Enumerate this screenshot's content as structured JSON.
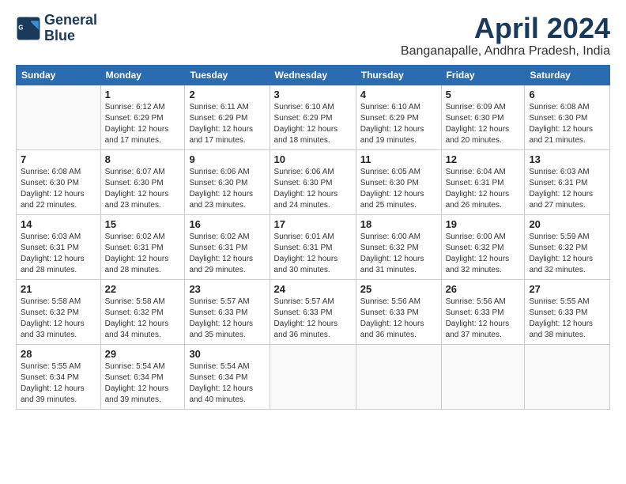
{
  "logo": {
    "line1": "General",
    "line2": "Blue"
  },
  "title": "April 2024",
  "subtitle": "Banganapalle, Andhra Pradesh, India",
  "days_of_week": [
    "Sunday",
    "Monday",
    "Tuesday",
    "Wednesday",
    "Thursday",
    "Friday",
    "Saturday"
  ],
  "weeks": [
    [
      {
        "day": "",
        "info": ""
      },
      {
        "day": "1",
        "info": "Sunrise: 6:12 AM\nSunset: 6:29 PM\nDaylight: 12 hours\nand 17 minutes."
      },
      {
        "day": "2",
        "info": "Sunrise: 6:11 AM\nSunset: 6:29 PM\nDaylight: 12 hours\nand 17 minutes."
      },
      {
        "day": "3",
        "info": "Sunrise: 6:10 AM\nSunset: 6:29 PM\nDaylight: 12 hours\nand 18 minutes."
      },
      {
        "day": "4",
        "info": "Sunrise: 6:10 AM\nSunset: 6:29 PM\nDaylight: 12 hours\nand 19 minutes."
      },
      {
        "day": "5",
        "info": "Sunrise: 6:09 AM\nSunset: 6:30 PM\nDaylight: 12 hours\nand 20 minutes."
      },
      {
        "day": "6",
        "info": "Sunrise: 6:08 AM\nSunset: 6:30 PM\nDaylight: 12 hours\nand 21 minutes."
      }
    ],
    [
      {
        "day": "7",
        "info": "Sunrise: 6:08 AM\nSunset: 6:30 PM\nDaylight: 12 hours\nand 22 minutes."
      },
      {
        "day": "8",
        "info": "Sunrise: 6:07 AM\nSunset: 6:30 PM\nDaylight: 12 hours\nand 23 minutes."
      },
      {
        "day": "9",
        "info": "Sunrise: 6:06 AM\nSunset: 6:30 PM\nDaylight: 12 hours\nand 23 minutes."
      },
      {
        "day": "10",
        "info": "Sunrise: 6:06 AM\nSunset: 6:30 PM\nDaylight: 12 hours\nand 24 minutes."
      },
      {
        "day": "11",
        "info": "Sunrise: 6:05 AM\nSunset: 6:30 PM\nDaylight: 12 hours\nand 25 minutes."
      },
      {
        "day": "12",
        "info": "Sunrise: 6:04 AM\nSunset: 6:31 PM\nDaylight: 12 hours\nand 26 minutes."
      },
      {
        "day": "13",
        "info": "Sunrise: 6:03 AM\nSunset: 6:31 PM\nDaylight: 12 hours\nand 27 minutes."
      }
    ],
    [
      {
        "day": "14",
        "info": "Sunrise: 6:03 AM\nSunset: 6:31 PM\nDaylight: 12 hours\nand 28 minutes."
      },
      {
        "day": "15",
        "info": "Sunrise: 6:02 AM\nSunset: 6:31 PM\nDaylight: 12 hours\nand 28 minutes."
      },
      {
        "day": "16",
        "info": "Sunrise: 6:02 AM\nSunset: 6:31 PM\nDaylight: 12 hours\nand 29 minutes."
      },
      {
        "day": "17",
        "info": "Sunrise: 6:01 AM\nSunset: 6:31 PM\nDaylight: 12 hours\nand 30 minutes."
      },
      {
        "day": "18",
        "info": "Sunrise: 6:00 AM\nSunset: 6:32 PM\nDaylight: 12 hours\nand 31 minutes."
      },
      {
        "day": "19",
        "info": "Sunrise: 6:00 AM\nSunset: 6:32 PM\nDaylight: 12 hours\nand 32 minutes."
      },
      {
        "day": "20",
        "info": "Sunrise: 5:59 AM\nSunset: 6:32 PM\nDaylight: 12 hours\nand 32 minutes."
      }
    ],
    [
      {
        "day": "21",
        "info": "Sunrise: 5:58 AM\nSunset: 6:32 PM\nDaylight: 12 hours\nand 33 minutes."
      },
      {
        "day": "22",
        "info": "Sunrise: 5:58 AM\nSunset: 6:32 PM\nDaylight: 12 hours\nand 34 minutes."
      },
      {
        "day": "23",
        "info": "Sunrise: 5:57 AM\nSunset: 6:33 PM\nDaylight: 12 hours\nand 35 minutes."
      },
      {
        "day": "24",
        "info": "Sunrise: 5:57 AM\nSunset: 6:33 PM\nDaylight: 12 hours\nand 36 minutes."
      },
      {
        "day": "25",
        "info": "Sunrise: 5:56 AM\nSunset: 6:33 PM\nDaylight: 12 hours\nand 36 minutes."
      },
      {
        "day": "26",
        "info": "Sunrise: 5:56 AM\nSunset: 6:33 PM\nDaylight: 12 hours\nand 37 minutes."
      },
      {
        "day": "27",
        "info": "Sunrise: 5:55 AM\nSunset: 6:33 PM\nDaylight: 12 hours\nand 38 minutes."
      }
    ],
    [
      {
        "day": "28",
        "info": "Sunrise: 5:55 AM\nSunset: 6:34 PM\nDaylight: 12 hours\nand 39 minutes."
      },
      {
        "day": "29",
        "info": "Sunrise: 5:54 AM\nSunset: 6:34 PM\nDaylight: 12 hours\nand 39 minutes."
      },
      {
        "day": "30",
        "info": "Sunrise: 5:54 AM\nSunset: 6:34 PM\nDaylight: 12 hours\nand 40 minutes."
      },
      {
        "day": "",
        "info": ""
      },
      {
        "day": "",
        "info": ""
      },
      {
        "day": "",
        "info": ""
      },
      {
        "day": "",
        "info": ""
      }
    ]
  ]
}
